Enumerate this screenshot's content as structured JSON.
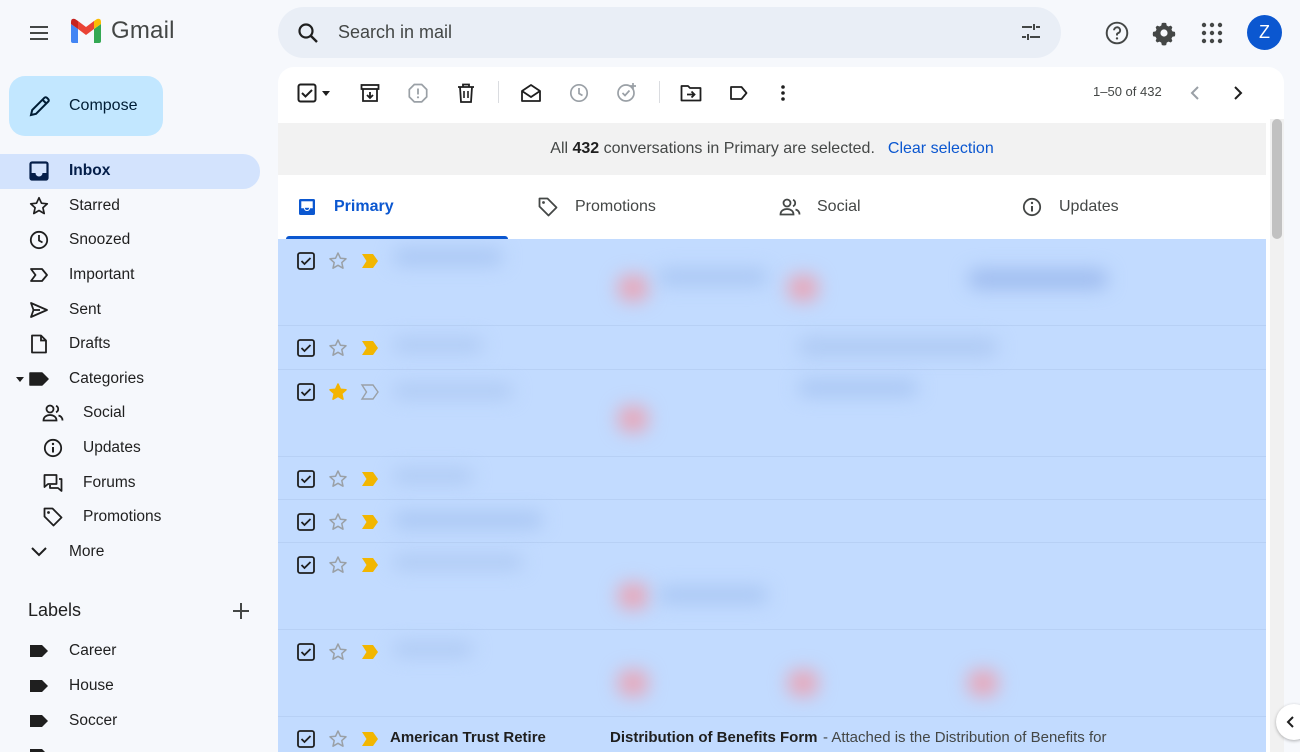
{
  "app": {
    "name": "Gmail",
    "avatar_initial": "Z"
  },
  "colors": {
    "brand_red": "#ea4335",
    "brand_blue": "#4285f4",
    "brand_green": "#34a853",
    "brand_yellow": "#fbbc04",
    "accent": "#0b57d0",
    "selected_row": "#c2dbff",
    "important_marker": "#f2b600",
    "starred": "#f4b400"
  },
  "search": {
    "placeholder": "Search in mail"
  },
  "compose": {
    "label": "Compose"
  },
  "nav": [
    {
      "label": "Inbox",
      "icon": "inbox-icon"
    },
    {
      "label": "Starred",
      "icon": "star-icon"
    },
    {
      "label": "Snoozed",
      "icon": "clock-icon"
    },
    {
      "label": "Important",
      "icon": "important-icon"
    },
    {
      "label": "Sent",
      "icon": "send-icon"
    },
    {
      "label": "Drafts",
      "icon": "draft-icon"
    },
    {
      "label": "Categories",
      "icon": "label-icon"
    },
    {
      "label": "Social",
      "icon": "people-icon"
    },
    {
      "label": "Updates",
      "icon": "info-icon"
    },
    {
      "label": "Forums",
      "icon": "forum-icon"
    },
    {
      "label": "Promotions",
      "icon": "tag-icon"
    },
    {
      "label": "More",
      "icon": "chevron-down-icon"
    }
  ],
  "labels": {
    "heading": "Labels",
    "items": [
      {
        "label": "Career"
      },
      {
        "label": "House"
      },
      {
        "label": "Soccer"
      }
    ]
  },
  "toolbar": {
    "pager": "1–50 of 432"
  },
  "banner": {
    "prefix": "All",
    "count": "432",
    "suffix": "conversations in Primary are selected.",
    "link": "Clear selection"
  },
  "tabs": [
    {
      "label": "Primary",
      "icon": "inbox-tab-icon"
    },
    {
      "label": "Promotions",
      "icon": "tag-icon"
    },
    {
      "label": "Social",
      "icon": "people-icon"
    },
    {
      "label": "Updates",
      "icon": "info-icon"
    }
  ],
  "last_row": {
    "sender": "American Trust Retire",
    "subject": "Distribution of Benefits Form",
    "snippet": "- Attached is the Distribution of Benefits for"
  }
}
